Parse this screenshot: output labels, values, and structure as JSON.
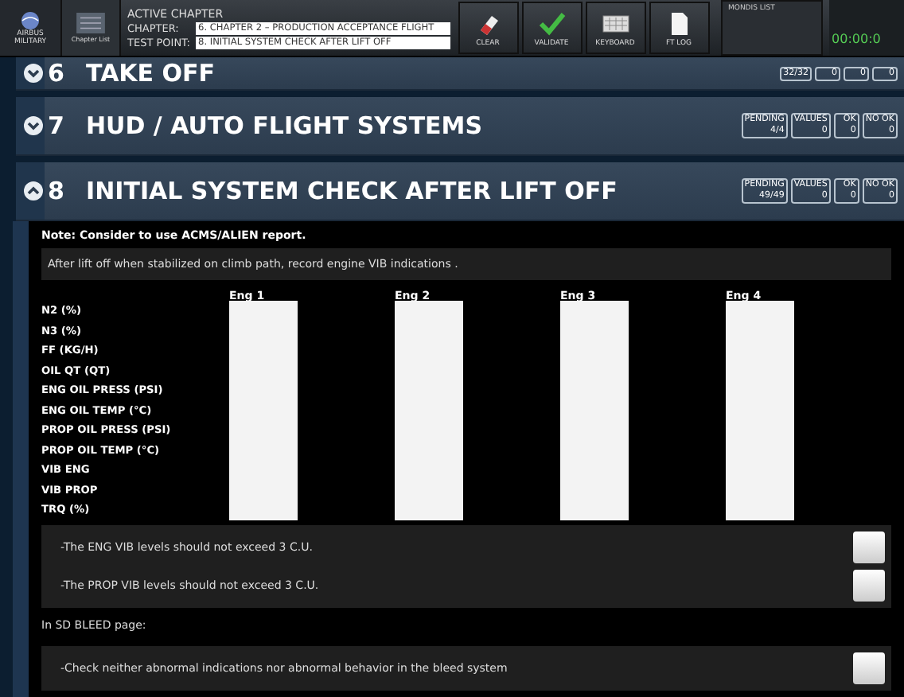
{
  "toolbar": {
    "logo": [
      "AIRBUS",
      "MILITARY"
    ],
    "chapter_list": "Chapter List",
    "active_chapter": "ACTIVE CHAPTER",
    "chapter_label": "CHAPTER:",
    "chapter_value": "6. CHAPTER 2 – PRODUCTION ACCEPTANCE FLIGHT",
    "test_point_label": "TEST POINT:",
    "test_point_value": "8. INITIAL SYSTEM CHECK AFTER LIFT OFF",
    "buttons": [
      {
        "kind": "clear",
        "label": "CLEAR"
      },
      {
        "kind": "validate",
        "label": "VALIDATE"
      },
      {
        "kind": "keyboard",
        "label": "KEYBOARD"
      },
      {
        "kind": "log",
        "label": "FT LOG"
      }
    ],
    "mondis": "MONDIS LIST",
    "timer": "00:00:0"
  },
  "sections": [
    {
      "number": "6",
      "title": "TAKE OFF",
      "expanded": false,
      "counters": [
        {
          "value": "32/32"
        },
        {
          "value": "0"
        },
        {
          "value": "0"
        },
        {
          "value": "0"
        }
      ]
    },
    {
      "number": "7",
      "title": "HUD / AUTO FLIGHT SYSTEMS",
      "expanded": false,
      "counters": [
        {
          "label": "PENDING",
          "value": "4/4"
        },
        {
          "label": "VALUES",
          "value": "0"
        },
        {
          "label": "OK",
          "value": "0"
        },
        {
          "label": "NO OK",
          "value": "0"
        }
      ]
    },
    {
      "number": "8",
      "title": "INITIAL SYSTEM CHECK AFTER LIFT OFF",
      "expanded": true,
      "counters": [
        {
          "label": "PENDING",
          "value": "49/49"
        },
        {
          "label": "VALUES",
          "value": "0"
        },
        {
          "label": "OK",
          "value": "0"
        },
        {
          "label": "NO OK",
          "value": "0"
        }
      ]
    }
  ],
  "content": {
    "note": "Note: Consider to use ACMS/ALIEN report.",
    "instruction": "After lift off when stabilized on climb path, record engine VIB indications .",
    "engines": [
      "Eng 1",
      "Eng 2",
      "Eng 3",
      "Eng 4"
    ],
    "parameters": [
      "N2 (%)",
      "N3 (%)",
      "FF  (KG/H)",
      "OIL QT (QT)",
      "ENG OIL PRESS  (PSI)",
      "ENG OIL TEMP  (°C)",
      "PROP OIL PRESS (PSI)",
      "PROP OIL TEMP (°C)",
      "VIB ENG",
      "VIB PROP",
      "TRQ (%)"
    ],
    "checks": [
      {
        "text": "-The ENG VIB levels should not exceed 3 C.U.",
        "checked": false
      },
      {
        "text": "-The PROP VIB levels should not exceed 3 C.U.",
        "checked": false
      }
    ],
    "bleed_heading": "In SD BLEED page:",
    "bleed_checks": [
      {
        "text": "-Check neither abnormal indications nor abnormal behavior in the bleed system",
        "checked": false
      }
    ]
  }
}
